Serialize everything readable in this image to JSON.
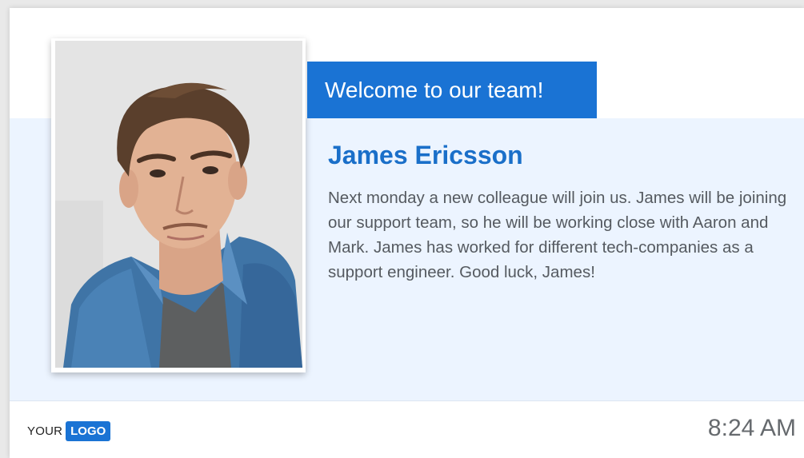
{
  "welcome": {
    "text": "Welcome to our team!"
  },
  "employee": {
    "name": "James Ericsson",
    "description": "Next monday a new colleague will join us. James will be joining our support team, so he will be working close with Aaron and Mark. James has worked for different tech-companies as a support engineer. Good luck, James!"
  },
  "footer": {
    "logo_prefix": "YOUR",
    "logo_badge": "LOGO",
    "time": "8:24 AM"
  },
  "colors": {
    "accent": "#1a73d4",
    "band": "#ecf4ff",
    "name": "#1a6fc9"
  }
}
